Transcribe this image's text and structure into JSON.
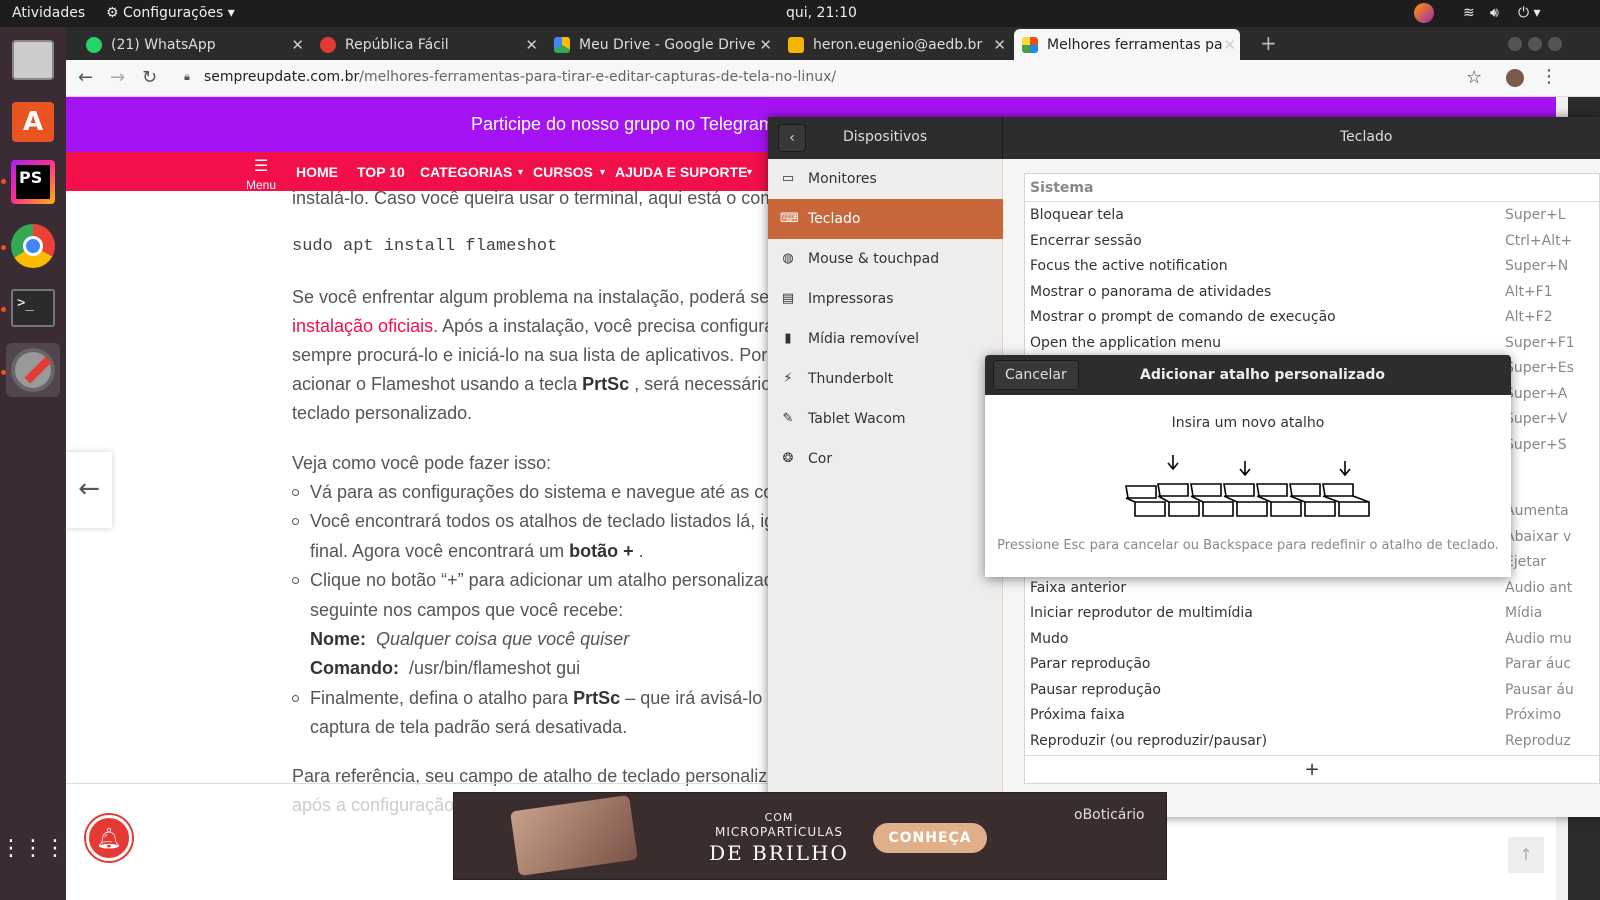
{
  "topbar": {
    "activities": "Atividades",
    "app_menu": "Configurações",
    "clock": "qui, 21:10"
  },
  "dock": {
    "items": [
      "files",
      "software",
      "phpstorm",
      "chrome",
      "terminal",
      "settings",
      "apps-grid"
    ]
  },
  "browser": {
    "tabs": [
      {
        "label": "(21) WhatsApp",
        "color": "#25d366"
      },
      {
        "label": "República Fácil",
        "color": "#e53935"
      },
      {
        "label": "Meu Drive - Google Drive",
        "color": "#fbbc04"
      },
      {
        "label": "heron.eugenio@aedb.br",
        "color": "#f4b400"
      },
      {
        "label": "Melhores ferramentas pa",
        "color": "#e94f1d"
      }
    ],
    "url_domain": "sempreupdate.com.br",
    "url_path": "/melhores-ferramentas-para-tirar-e-editar-capturas-de-tela-no-linux/"
  },
  "website": {
    "banner": "Participe do nosso grupo no Telegram",
    "menu_label": "Menu",
    "nav": [
      "HOME",
      "TOP 10",
      "CATEGORIAS",
      "CURSOS",
      "AJUDA E SUPORTE"
    ],
    "p1_line": "instalá-lo. Caso você queira usar o terminal, aqui está o coma",
    "code": "sudo apt install flameshot",
    "p2": [
      "Se você enfrentar algum problema na instalação, poderá segu",
      "instalação oficiais",
      ". Após a instalação, você precisa configurá",
      "sempre procurá-lo e iniciá-lo na sua lista de aplicativos. Porém",
      "acionar o Flameshot usando a tecla ",
      "PrtSc",
      " , será necessário a",
      "teclado personalizado."
    ],
    "p3": "Veja como você pode fazer isso:",
    "list": [
      "Vá para as configurações do sistema e navegue até as con",
      "Você encontrará todos os atalhos de teclado listados lá, ig",
      "final. Agora você encontrará um ",
      "botão +",
      " .",
      "Clique no botão “+” para adicionar um atalho personalizado",
      "seguinte nos campos que você recebe:",
      "Nome:",
      "Qualquer coisa que você quiser",
      "Comando:",
      "/usr/bin/flameshot gui",
      "Finalmente, defina o atalho para ",
      "PrtSc",
      " – que irá avisá-lo qu",
      "captura de tela padrão será desativada."
    ],
    "p4": "Para referência, seu campo de atalho de teclado personalizad",
    "p5": "após a configuração"
  },
  "settings": {
    "left_title": "Dispositivos",
    "right_title": "Teclado",
    "sidebar": [
      {
        "label": "Monitores",
        "icon": "monitor-icon"
      },
      {
        "label": "Teclado",
        "icon": "keyboard-icon",
        "selected": true
      },
      {
        "label": "Mouse & touchpad",
        "icon": "mouse-icon"
      },
      {
        "label": "Impressoras",
        "icon": "printer-icon"
      },
      {
        "label": "Mídia removível",
        "icon": "usb-icon"
      },
      {
        "label": "Thunderbolt",
        "icon": "thunderbolt-icon"
      },
      {
        "label": "Tablet Wacom",
        "icon": "tablet-icon"
      },
      {
        "label": "Cor",
        "icon": "color-icon"
      }
    ],
    "section": "Sistema",
    "shortcuts": [
      {
        "name": "Bloquear tela",
        "key": "Super+L"
      },
      {
        "name": "Encerrar sessão",
        "key": "Ctrl+Alt+"
      },
      {
        "name": "Focus the active notification",
        "key": "Super+N"
      },
      {
        "name": "Mostrar o panorama de atividades",
        "key": "Alt+F1"
      },
      {
        "name": "Mostrar o prompt de comando de execução",
        "key": "Alt+F2"
      },
      {
        "name": "Open the application menu",
        "key": "Super+F1"
      }
    ],
    "hidden_keys": [
      "Super+Es",
      "Super+A",
      "Super+V",
      "Super+S",
      "Aumenta",
      "Abaixar v",
      "Ejetar"
    ],
    "media_shortcuts": [
      {
        "name": "Faixa anterior",
        "key": "Áudio ant"
      },
      {
        "name": "Iniciar reprodutor de multimídia",
        "key": "Mídia"
      },
      {
        "name": "Mudo",
        "key": "Áudio mu"
      },
      {
        "name": "Parar reprodução",
        "key": "Parar áuc"
      },
      {
        "name": "Pausar reprodução",
        "key": "Pausar áu"
      },
      {
        "name": "Próxima faixa",
        "key": "Próximo"
      },
      {
        "name": "Reproduzir (ou reproduzir/pausar)",
        "key": "Reproduz"
      }
    ],
    "add_label": "+"
  },
  "dialog": {
    "cancel": "Cancelar",
    "title": "Adicionar atalho personalizado",
    "prompt": "Insira um novo atalho",
    "hint": "Pressione Esc para cancelar ou Backspace para redefinir o atalho de teclado."
  },
  "ad": {
    "l1": "COM",
    "l2": "MICROPARTÍCULAS",
    "l3": "DE BRILHO",
    "cta": "CONHEÇA",
    "brand": "oBoticário"
  }
}
